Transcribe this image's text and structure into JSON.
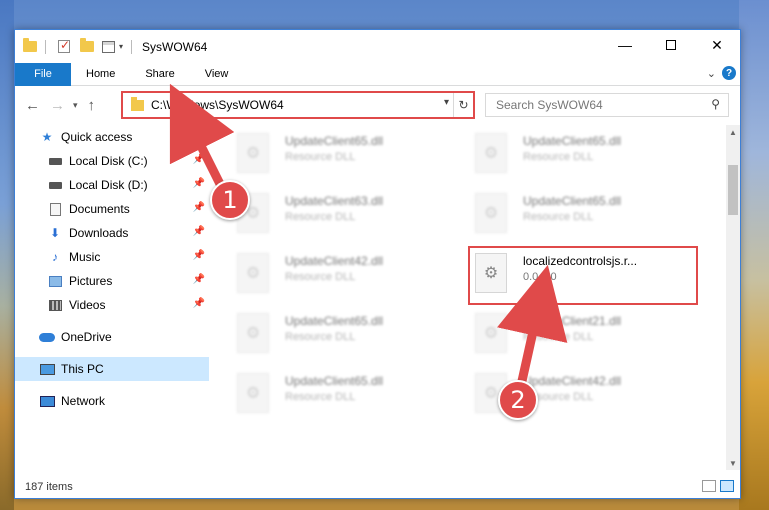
{
  "window": {
    "title": "SysWOW64",
    "minimize": "—",
    "close": "✕"
  },
  "ribbon": {
    "file": "File",
    "home": "Home",
    "share": "Share",
    "view": "View",
    "help": "?"
  },
  "navigation": {
    "back": "←",
    "forward": "→",
    "recent": "▾",
    "up": "↑",
    "address": "C:\\Windows\\SysWOW64",
    "search_placeholder": "Search SysWOW64"
  },
  "sidebar": {
    "items": [
      {
        "label": "Quick access",
        "icon": "star-icon"
      },
      {
        "label": "Local Disk (C:)",
        "icon": "disk-icon"
      },
      {
        "label": "Local Disk (D:)",
        "icon": "disk-icon"
      },
      {
        "label": "Documents",
        "icon": "documents-icon"
      },
      {
        "label": "Downloads",
        "icon": "downloads-icon"
      },
      {
        "label": "Music",
        "icon": "music-icon"
      },
      {
        "label": "Pictures",
        "icon": "pictures-icon"
      },
      {
        "label": "Videos",
        "icon": "videos-icon"
      },
      {
        "label": "OneDrive",
        "icon": "cloud-icon"
      },
      {
        "label": "This PC",
        "icon": "pc-icon"
      },
      {
        "label": "Network",
        "icon": "network-icon"
      }
    ]
  },
  "files": [
    {
      "name": "UpdateClient65.dll",
      "type": "Resource DLL"
    },
    {
      "name": "UpdateClient65.dll",
      "type": "Resource DLL"
    },
    {
      "name": "UpdateClient63.dll",
      "type": "Resource DLL"
    },
    {
      "name": "UpdateClient65.dll",
      "type": "Resource DLL"
    },
    {
      "name": "UpdateClient42.dll",
      "type": "Resource DLL"
    },
    {
      "name": "localizedcontrolsjs.r...",
      "type": "0.0.0.0"
    },
    {
      "name": "UpdateClient65.dll",
      "type": "Resource DLL"
    },
    {
      "name": "UpdateClient21.dll",
      "type": "Resource DLL"
    },
    {
      "name": "UpdateClient65.dll",
      "type": "Resource DLL"
    },
    {
      "name": "UpdateClient42.dll",
      "type": "Resource DLL"
    }
  ],
  "status": {
    "items": "187 items"
  },
  "annotations": {
    "step1": "1",
    "step2": "2"
  },
  "colors": {
    "accent": "#1979ca",
    "highlight": "#e04a4a"
  }
}
